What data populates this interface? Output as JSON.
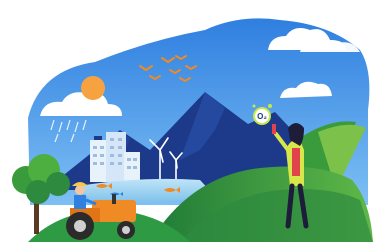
{
  "illustration": {
    "o2_badge_text": "O₂"
  },
  "colors": {
    "sky_blue": "#2f80e0",
    "sky_light": "#8fc6f4",
    "mountain": "#1d3a8a",
    "mountain_dark": "#15296b",
    "sun": "#f7a240",
    "hill_green": "#2e9a44",
    "hill_light": "#7cc24a",
    "lake": "#9fd3f2",
    "tractor": "#f08a24",
    "woman_jacket": "#d9e64a",
    "woman_shirt": "#e0434b",
    "birds": "#f08a24"
  }
}
